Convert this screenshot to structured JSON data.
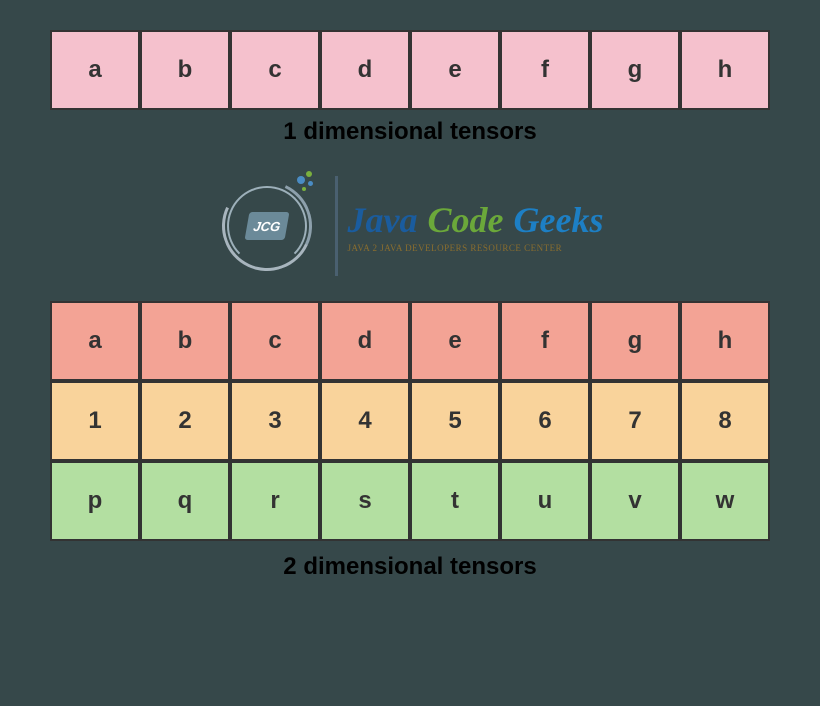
{
  "tensor1d": {
    "cells": [
      "a",
      "b",
      "c",
      "d",
      "e",
      "f",
      "g",
      "h"
    ],
    "caption": "1 dimensional tensors"
  },
  "logo": {
    "badge": "JCG",
    "word1": "Java",
    "word2": "Code",
    "word3": "Geeks",
    "subtitle": "JAVA 2 JAVA DEVELOPERS RESOURCE CENTER"
  },
  "tensor2d": {
    "row1": [
      "a",
      "b",
      "c",
      "d",
      "e",
      "f",
      "g",
      "h"
    ],
    "row2": [
      "1",
      "2",
      "3",
      "4",
      "5",
      "6",
      "7",
      "8"
    ],
    "row3": [
      "p",
      "q",
      "r",
      "s",
      "t",
      "u",
      "v",
      "w"
    ],
    "caption": "2 dimensional tensors"
  }
}
